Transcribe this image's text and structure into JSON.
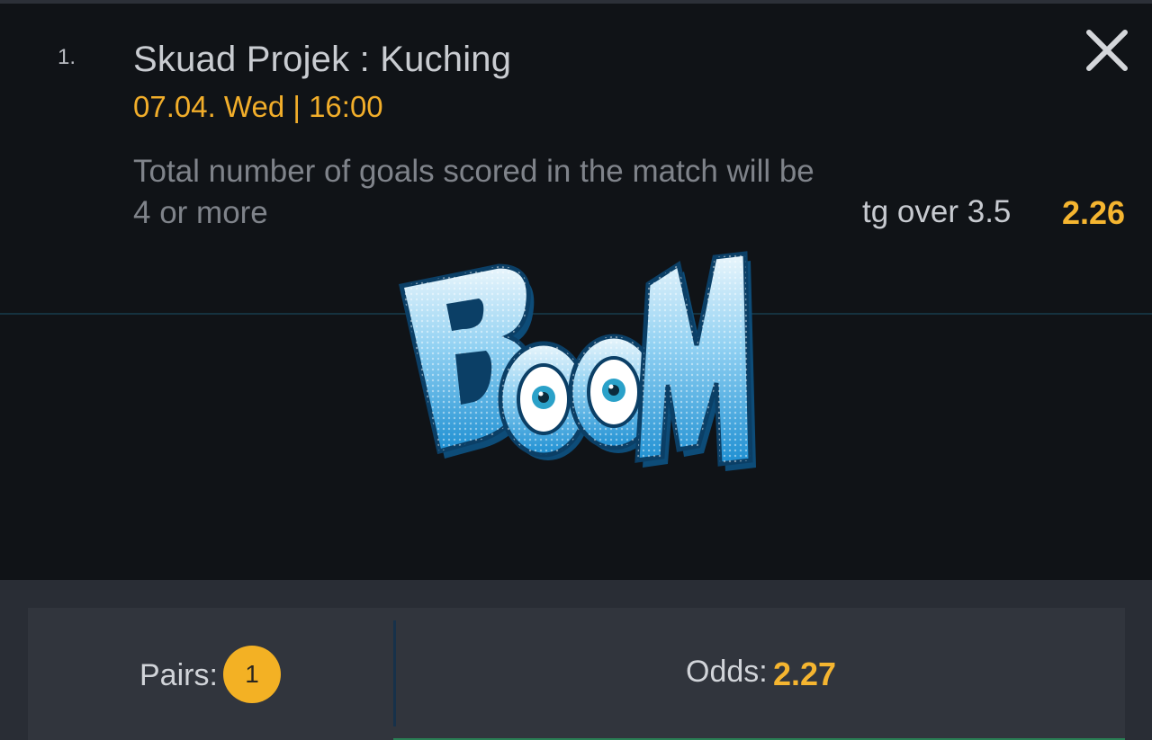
{
  "bet": {
    "index": "1.",
    "match": "Skuad Projek : Kuching",
    "datetime": "07.04. Wed | 16:00",
    "market_description": "Total number of goals scored in the match will be 4 or more",
    "selection": "tg over 3.5",
    "odds": "2.26"
  },
  "controls": {
    "close_icon": "close-icon"
  },
  "overlay": {
    "sticker": "boom-sticker"
  },
  "footer": {
    "pairs_label": "Pairs:",
    "pairs_count": "1",
    "odds_label": "Odds:",
    "total_odds": "2.27"
  },
  "colors": {
    "background": "#101317",
    "accent": "#f5b530",
    "footer": "#31353d"
  }
}
